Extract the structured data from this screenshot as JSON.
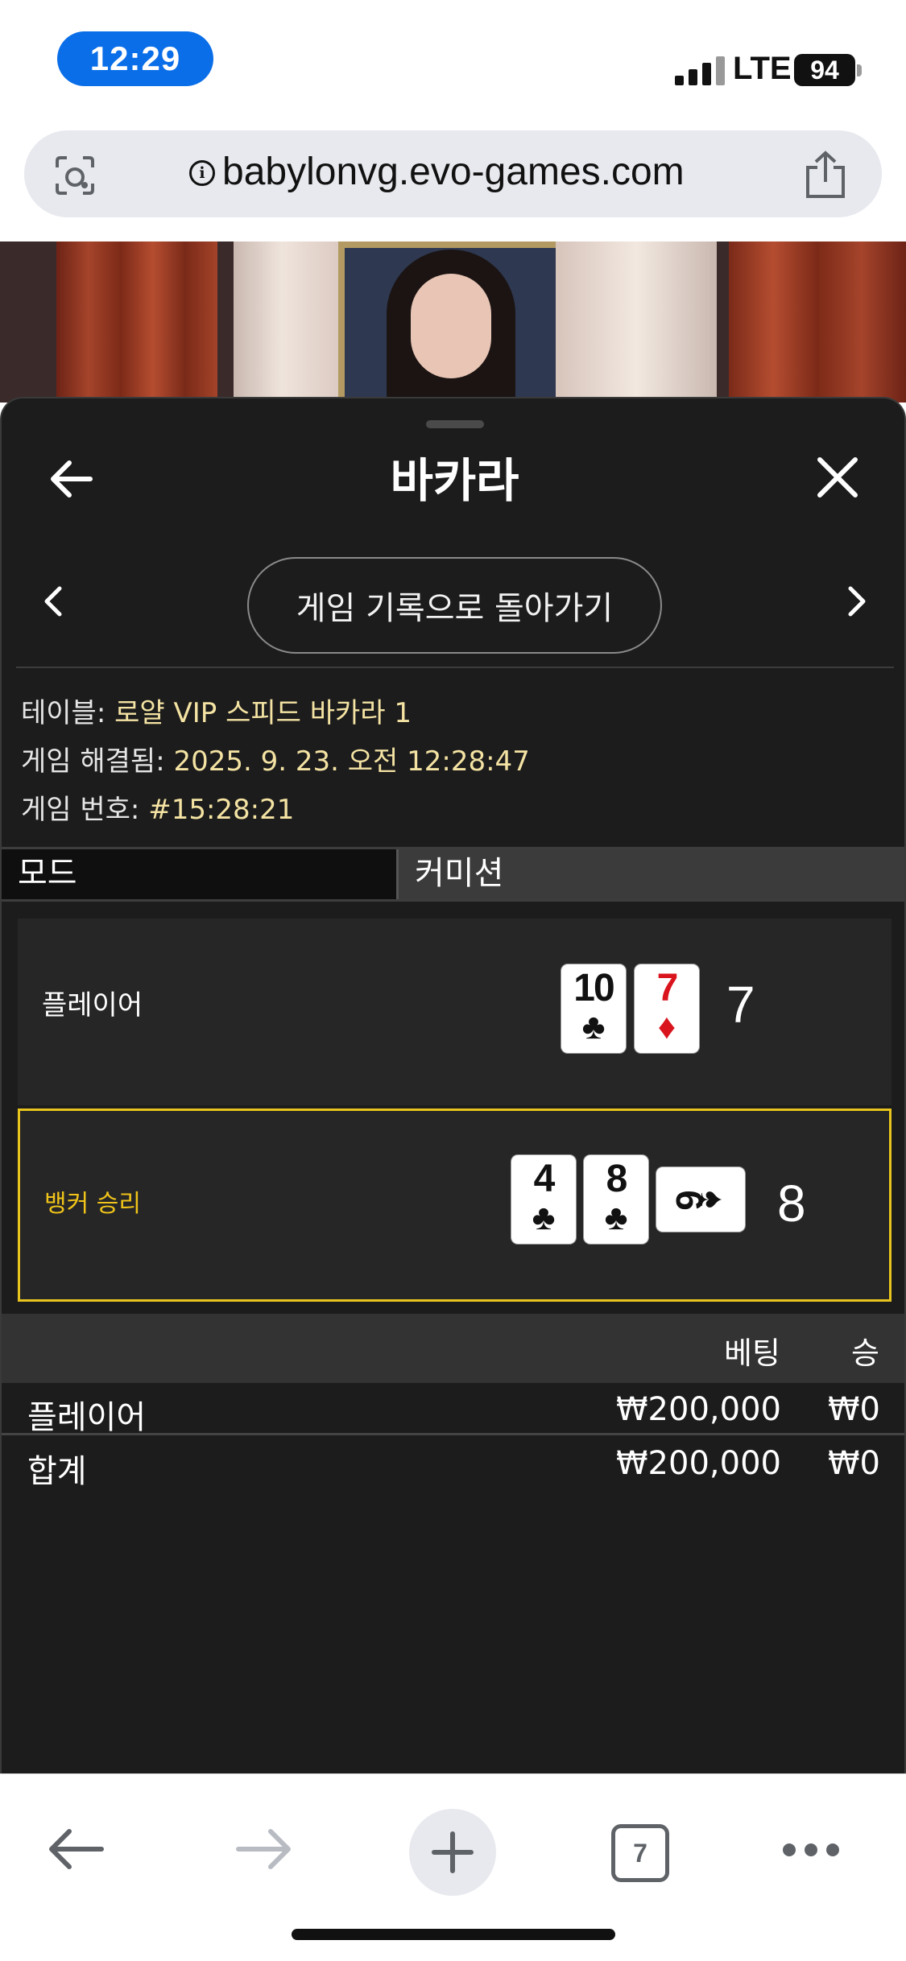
{
  "status_bar": {
    "time": "12:29",
    "network": "LTE",
    "battery": "94"
  },
  "browser": {
    "url": "babylonvg.evo-games.com",
    "tab_count": "7"
  },
  "panel": {
    "title": "바카라",
    "history_button": "게임 기록으로 돌아가기",
    "info": {
      "table_label": "테이블: ",
      "table_value": "로얄 VIP 스피드 바카라 1",
      "resolved_label": "게임 해결됨: ",
      "resolved_value": "2025. 9. 23. 오전 12:28:47",
      "number_label": "게임 번호: ",
      "number_value": "#15:28:21"
    },
    "mode": {
      "label": "모드",
      "value": "커미션"
    },
    "player_hand": {
      "label": "플레이어",
      "cards": [
        {
          "rank": "10",
          "suit": "♣",
          "color": "black"
        },
        {
          "rank": "7",
          "suit": "♦",
          "color": "red"
        }
      ],
      "score": "7"
    },
    "banker_hand": {
      "label": "뱅커 승리",
      "cards": [
        {
          "rank": "4",
          "suit": "♣",
          "color": "black"
        },
        {
          "rank": "8",
          "suit": "♣",
          "color": "black"
        },
        {
          "rank": "6",
          "suit": "♠",
          "color": "black",
          "sideways": true
        }
      ],
      "score": "8"
    },
    "bets": {
      "header_bet": "베팅",
      "header_win": "승",
      "rows": [
        {
          "label": "플레이어",
          "bet": "₩200,000",
          "win": "₩0"
        },
        {
          "label": "합계",
          "bet": "₩200,000",
          "win": "₩0"
        }
      ]
    }
  },
  "colors": {
    "accent_blue": "#0a6ee8",
    "winner_yellow": "#e8c51e",
    "info_value": "#f4e3a3",
    "panel_bg": "#1c1c1c"
  },
  "icons": [
    "camera-lens-icon",
    "info-icon",
    "share-icon",
    "back-arrow-icon",
    "close-icon",
    "chevron-left-icon",
    "chevron-right-icon",
    "plus-icon",
    "tabs-icon",
    "more-icon"
  ]
}
